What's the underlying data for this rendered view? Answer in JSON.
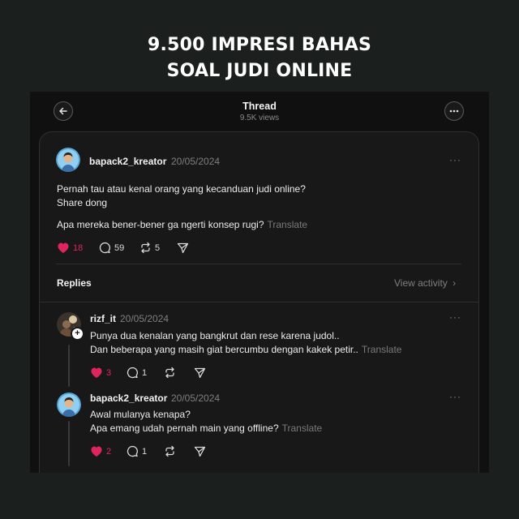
{
  "headline": {
    "line1": "9.500 IMPRESI BAHAS",
    "line2": "SOAL JUDI ONLINE"
  },
  "header": {
    "title": "Thread",
    "views": "9.5K views",
    "back_icon": "arrow-left-icon",
    "more_icon": "more-horizontal-icon"
  },
  "main_post": {
    "username": "bapack2_kreator",
    "date": "20/05/2024",
    "lines": [
      "Pernah tau atau kenal orang yang kecanduan judi online?",
      "Share dong",
      "Apa mereka bener-bener ga ngerti konsep rugi?"
    ],
    "translate": "Translate",
    "likes": "18",
    "comments": "59",
    "reposts": "5"
  },
  "replies_section": {
    "label": "Replies",
    "view_activity": "View activity"
  },
  "replies": [
    {
      "username": "rizf_it",
      "date": "20/05/2024",
      "lines": [
        "Punya dua kenalan yang bangkrut dan rese karena judol..",
        "Dan beberapa yang masih giat bercumbu dengan kakek petir.."
      ],
      "translate": "Translate",
      "likes": "3",
      "comments": "1"
    },
    {
      "username": "bapack2_kreator",
      "date": "20/05/2024",
      "lines": [
        "Awal mulanya kenapa?",
        "Apa emang udah pernah main yang offline?"
      ],
      "translate": "Translate",
      "likes": "2",
      "comments": "1"
    }
  ],
  "colors": {
    "background": "#1b1f1d",
    "screen": "#101010",
    "card": "#181818",
    "like": "#e0245e",
    "muted": "#7f7f7f"
  }
}
